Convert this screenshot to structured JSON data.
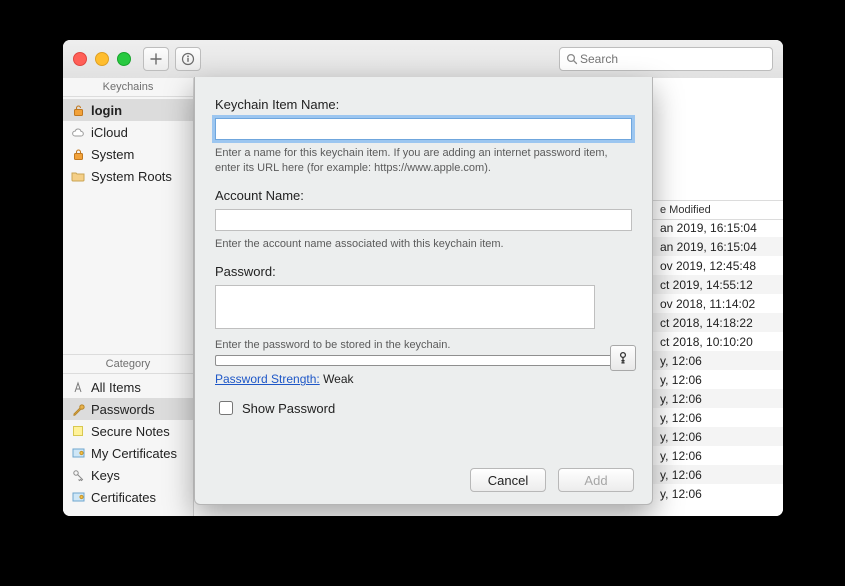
{
  "toolbar": {
    "search_placeholder": "Search"
  },
  "sidebar": {
    "keychains_header": "Keychains",
    "category_header": "Category",
    "keychains": [
      {
        "label": "login"
      },
      {
        "label": "iCloud"
      },
      {
        "label": "System"
      },
      {
        "label": "System Roots"
      }
    ],
    "categories": [
      {
        "label": "All Items"
      },
      {
        "label": "Passwords"
      },
      {
        "label": "Secure Notes"
      },
      {
        "label": "My Certificates"
      },
      {
        "label": "Keys"
      },
      {
        "label": "Certificates"
      }
    ]
  },
  "list": {
    "col_date": "e Modified",
    "rows": [
      "an 2019, 16:15:04",
      "an 2019, 16:15:04",
      "ov 2019, 12:45:48",
      "ct 2019, 14:55:12",
      "ov 2018, 11:14:02",
      "ct 2018, 14:18:22",
      "ct 2018, 10:10:20",
      "y, 12:06",
      "y, 12:06",
      "y, 12:06",
      "y, 12:06",
      "y, 12:06",
      "y, 12:06",
      "y, 12:06",
      "y, 12:06"
    ]
  },
  "dialog": {
    "item_name_label": "Keychain Item Name:",
    "item_name_value": "",
    "item_name_help": "Enter a name for this keychain item. If you are adding an internet password item, enter its URL here (for example: https://www.apple.com).",
    "account_label": "Account Name:",
    "account_value": "",
    "account_help": "Enter the account name associated with this keychain item.",
    "password_label": "Password:",
    "password_value": "",
    "password_help": "Enter the password to be stored in the keychain.",
    "ps_link": "Password Strength:",
    "ps_value": "Weak",
    "show_password": "Show Password",
    "cancel": "Cancel",
    "add": "Add"
  }
}
